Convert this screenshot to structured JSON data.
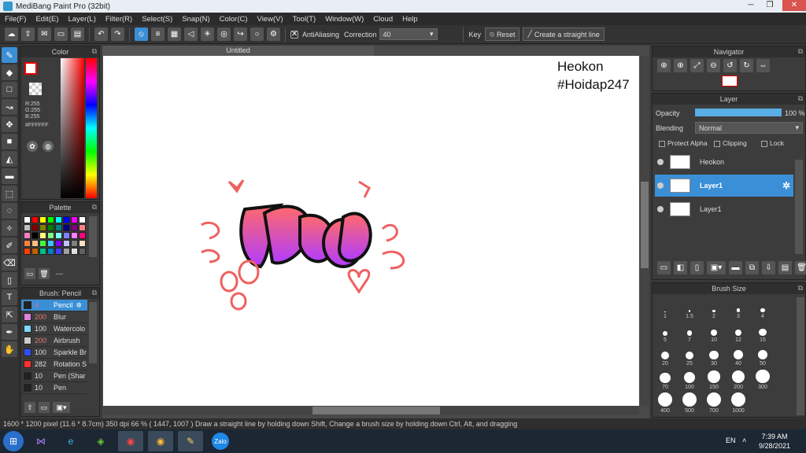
{
  "window": {
    "title": "MediBang Paint Pro (32bit)"
  },
  "menu": [
    "File(F)",
    "Edit(E)",
    "Layer(L)",
    "Filter(R)",
    "Select(S)",
    "Snap(N)",
    "Color(C)",
    "View(V)",
    "Tool(T)",
    "Window(W)",
    "Cloud",
    "Help"
  ],
  "toolbar": {
    "antialiasing_label": "AntiAliasing",
    "correction_label": "Correction",
    "correction_value": "40",
    "key_label": "Key",
    "reset_label": "Reset",
    "straight_line_label": "Create a straight line"
  },
  "color_panel": {
    "title": "Color",
    "r": "R:255",
    "g": "G:255",
    "b": "B:255",
    "hex": "#FFFFFF"
  },
  "palette_panel": {
    "title": "Palette",
    "dash": "---",
    "colors": [
      "#ffffff",
      "#ff0000",
      "#ffff00",
      "#00ff00",
      "#00ffff",
      "#0000ff",
      "#ff00ff",
      "#ffffff",
      "#c0c0c0",
      "#800000",
      "#808000",
      "#008000",
      "#008080",
      "#000080",
      "#800080",
      "#ff8080",
      "#ff80c0",
      "#000000",
      "#ffff80",
      "#80ff80",
      "#80ffff",
      "#8080ff",
      "#ff80ff",
      "#ff0080",
      "#ff8040",
      "#ffc080",
      "#40ff40",
      "#40c0ff",
      "#8000ff",
      "#c0c0ff",
      "#808080",
      "#ffe0c0",
      "#ff4000",
      "#c06000",
      "#00c080",
      "#0080c0",
      "#4040ff",
      "#a0a0a0",
      "#e0e0e0",
      "#606060"
    ]
  },
  "brush_panel": {
    "title": "Brush: Pencil",
    "items": [
      {
        "size": "4",
        "name": "Pencil",
        "color": "#222222"
      },
      {
        "size": "200",
        "name": "Blur",
        "color": "#e080e0"
      },
      {
        "size": "100",
        "name": "Watercolo",
        "color": "#80d8ff"
      },
      {
        "size": "200",
        "name": "Airbrush",
        "color": "#cccccc"
      },
      {
        "size": "100",
        "name": "Sparkle Br",
        "color": "#3050ff"
      },
      {
        "size": "282",
        "name": "Rotation S",
        "color": "#ff3030"
      },
      {
        "size": "10",
        "name": "Pen (Shar",
        "color": "#222222"
      },
      {
        "size": "10",
        "name": "Pen",
        "color": "#222222"
      }
    ]
  },
  "document": {
    "tab_title": "Untitled",
    "watermark_line1": "Heokon",
    "watermark_line2": "#Hoidap247"
  },
  "navigator": {
    "title": "Navigator"
  },
  "layer_panel": {
    "title": "Layer",
    "opacity_label": "Opacity",
    "opacity_value": "100 %",
    "opacity_fraction": 1.0,
    "blending_label": "Blending",
    "blending_value": "Normal",
    "protect_alpha": "Protect Alpha",
    "clipping": "Clipping",
    "lock": "Lock",
    "layers": [
      "Heokon",
      "Layer1",
      "Layer1"
    ]
  },
  "brush_size_panel": {
    "title": "Brush Size",
    "sizes": [
      "1",
      "1.5",
      "2",
      "3",
      "4",
      "5",
      "7",
      "10",
      "12",
      "15",
      "20",
      "25",
      "30",
      "40",
      "50",
      "70",
      "100",
      "150",
      "200",
      "300",
      "400",
      "500",
      "700",
      "1000"
    ]
  },
  "status": {
    "text": "1600 * 1200 pixel   (11.6 * 8.7cm)   350 dpi   66 %   ( 1447, 1007 )   Draw a straight line by holding down Shift, Change a brush size by holding down Ctrl, Alt, and dragging"
  },
  "taskbar": {
    "lang": "EN",
    "time": "7:39 AM",
    "date": "9/28/2021",
    "zalo": "Zalo"
  }
}
